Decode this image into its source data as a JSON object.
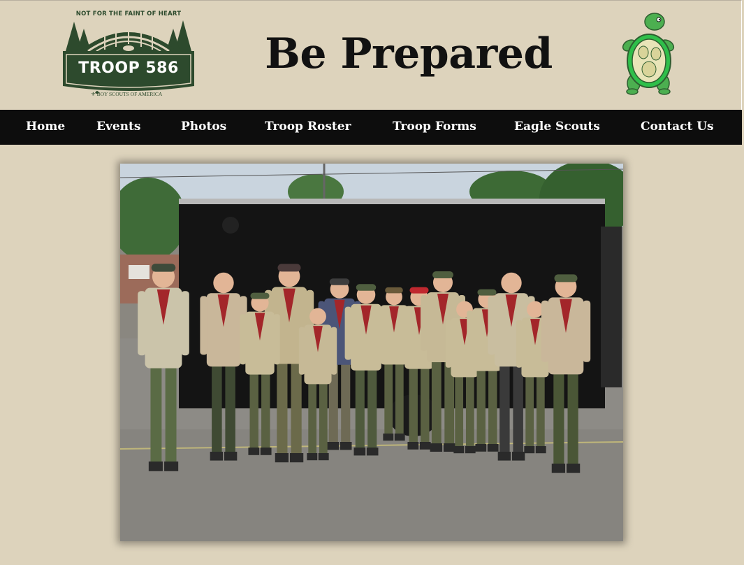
{
  "header": {
    "logo": {
      "tagline": "NOT FOR THE FAINT OF HEART",
      "name": "TROOP 586",
      "affiliation": "BOY SCOUTS OF AMERICA",
      "colors": {
        "green": "#2d4a2d",
        "cream": "#ddd3bc"
      }
    },
    "title": "Be Prepared",
    "mascot_icon": "turtle-mascot-icon"
  },
  "nav": {
    "items": [
      {
        "label": "Home"
      },
      {
        "label": "Events"
      },
      {
        "label": "Photos"
      },
      {
        "label": "Troop Roster"
      },
      {
        "label": "Troop Forms"
      },
      {
        "label": "Eagle Scouts"
      },
      {
        "label": "Contact Us"
      }
    ],
    "background": "#0d0d0d",
    "text_color": "#ffffff"
  },
  "main": {
    "photo_icon": "troop-group-photo"
  },
  "colors": {
    "page_background": "#ddd3bc"
  }
}
